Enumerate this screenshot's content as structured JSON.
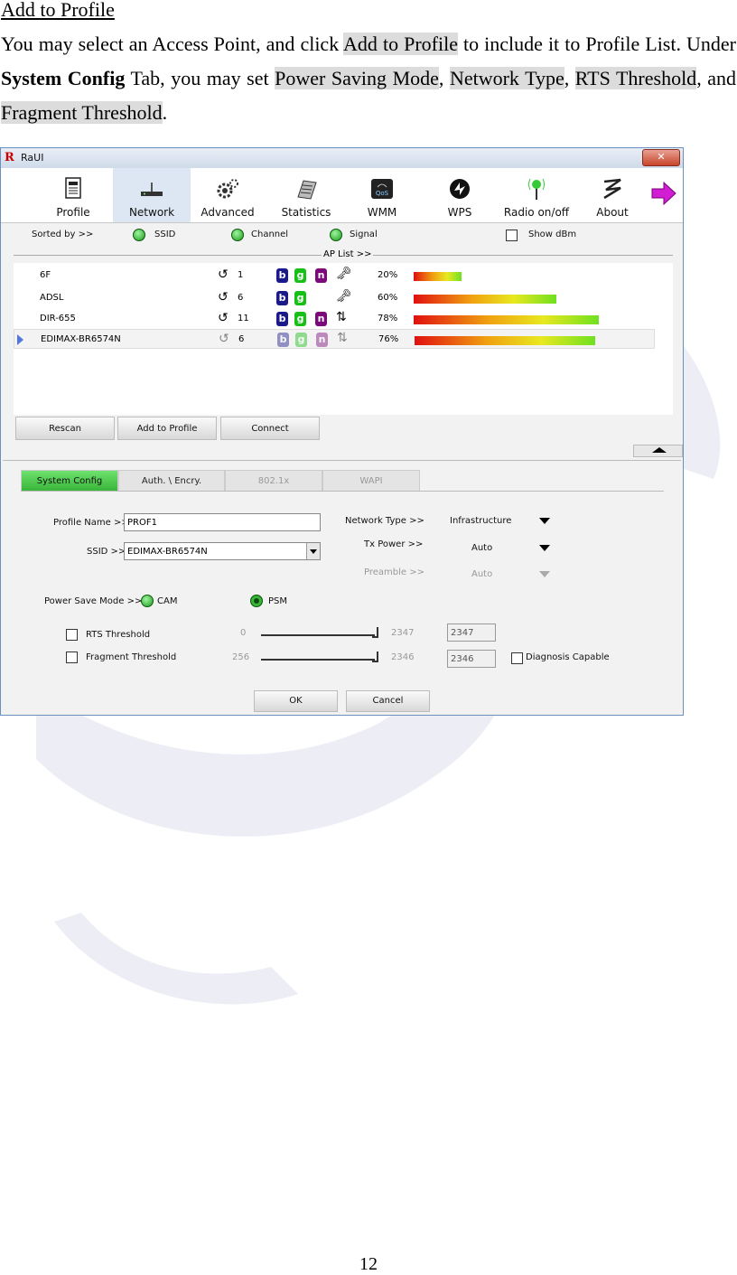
{
  "doc": {
    "heading": "Add to Profile",
    "para": {
      "t1": "You may select an Access Point, and click ",
      "h1": "Add to Profile",
      "t2": " to include it to Profile List. Under ",
      "b1": "System Config",
      "t3": " Tab, you may set ",
      "h2": "Power Saving Mode",
      "t4": ", ",
      "h3": "Network Type",
      "t5": ", ",
      "h4": "RTS Threshold",
      "t6": ", and ",
      "h5": "Fragment Threshold",
      "t7": "."
    },
    "page_number": "12"
  },
  "window": {
    "logo": "R",
    "title": "RaUI",
    "close": "✕"
  },
  "toolbar": {
    "items": [
      {
        "label": "Profile",
        "icon": "profile-icon"
      },
      {
        "label": "Network",
        "icon": "network-icon",
        "active": true
      },
      {
        "label": "Advanced",
        "icon": "advanced-icon"
      },
      {
        "label": "Statistics",
        "icon": "statistics-icon"
      },
      {
        "label": "WMM",
        "icon": "wmm-icon"
      },
      {
        "label": "WPS",
        "icon": "wps-icon"
      },
      {
        "label": "Radio on/off",
        "icon": "radio-icon"
      },
      {
        "label": "About",
        "icon": "about-icon"
      }
    ]
  },
  "sortbar": {
    "sorted_by": "Sorted by >>",
    "ssid": "SSID",
    "channel": "Channel",
    "signal": "Signal",
    "show_dbm": "Show dBm",
    "ap_list": "AP List >>"
  },
  "ap_list": [
    {
      "ssid": "6F",
      "channel": "1",
      "b": "b",
      "g": "g",
      "n": "n",
      "signal": "20%",
      "fraction": 0.2
    },
    {
      "ssid": "ADSL",
      "channel": "6",
      "b": "b",
      "g": "g",
      "n": "",
      "signal": "60%",
      "fraction": 0.6
    },
    {
      "ssid": "DIR-655",
      "channel": "11",
      "b": "b",
      "g": "g",
      "n": "n",
      "signal": "78%",
      "fraction": 0.78
    },
    {
      "ssid": "EDIMAX-BR6574N",
      "channel": "6",
      "b": "b",
      "g": "g",
      "n": "n",
      "signal": "76%",
      "fraction": 0.76,
      "selected": true
    }
  ],
  "buttons": {
    "rescan": "Rescan",
    "add_to_profile": "Add to Profile",
    "connect": "Connect",
    "ok": "OK",
    "cancel": "Cancel"
  },
  "tabs": [
    {
      "label": "System Config",
      "state": "active"
    },
    {
      "label": "Auth. \\ Encry.",
      "state": "normal"
    },
    {
      "label": "802.1x",
      "state": "disabled"
    },
    {
      "label": "WAPI",
      "state": "disabled"
    }
  ],
  "config": {
    "profile_name_label": "Profile Name >>",
    "profile_name_value": "PROF1",
    "ssid_label": "SSID >>",
    "ssid_value": "EDIMAX-BR6574N",
    "network_type_label": "Network Type >>",
    "network_type_value": "Infrastructure",
    "tx_power_label": "Tx Power >>",
    "tx_power_value": "Auto",
    "preamble_label": "Preamble >>",
    "preamble_value": "Auto",
    "power_save_label": "Power Save Mode >>",
    "cam": "CAM",
    "psm": "PSM",
    "rts_label": "RTS Threshold",
    "rts_min": "0",
    "rts_max": "2347",
    "rts_value": "2347",
    "frag_label": "Fragment Threshold",
    "frag_min": "256",
    "frag_max": "2346",
    "frag_value": "2346",
    "diagnosis": "Diagnosis Capable"
  }
}
